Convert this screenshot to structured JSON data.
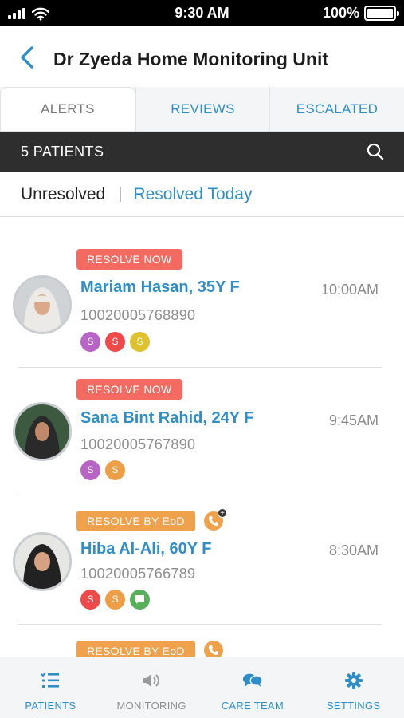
{
  "status_bar": {
    "time": "9:30 AM",
    "battery": "100%"
  },
  "header": {
    "title": "Dr Zyeda Home Monitoring Unit"
  },
  "tabs": [
    {
      "label": "ALERTS",
      "active": true
    },
    {
      "label": "REVIEWS",
      "active": false
    },
    {
      "label": "ESCALATED",
      "active": false
    }
  ],
  "patients_bar": {
    "count_label": "5 PATIENTS"
  },
  "filter": {
    "unresolved": "Unresolved",
    "separator": "|",
    "resolved_today": "Resolved Today"
  },
  "patients": [
    {
      "badge": "RESOLVE NOW",
      "name": "Mariam Hasan, 35Y F",
      "time": "10:00AM",
      "id": "10020005768890",
      "chips": [
        {
          "label": "S",
          "color": "#b864c6"
        },
        {
          "label": "S",
          "color": "#ee4a4a"
        },
        {
          "label": "S",
          "color": "#ddc12e"
        }
      ]
    },
    {
      "badge": "RESOLVE NOW",
      "name": "Sana Bint Rahid, 24Y F",
      "time": "9:45AM",
      "id": "10020005767890",
      "chips": [
        {
          "label": "S",
          "color": "#b864c6"
        },
        {
          "label": "S",
          "color": "#ee9e46"
        }
      ]
    },
    {
      "badge": "RESOLVE BY EoD",
      "name": "Hiba Al-Ali, 60Y F",
      "time": "8:30AM",
      "id": "10020005766789",
      "chips": [
        {
          "label": "S",
          "color": "#ee4a4a"
        },
        {
          "label": "S",
          "color": "#ee9e46"
        },
        {
          "label": "chat-icon",
          "color": "#59b05a"
        }
      ]
    },
    {
      "badge": "RESOLVE BY EoD"
    }
  ],
  "bottom_nav": [
    {
      "label": "PATIENTS",
      "icon": "patients-list-icon",
      "active": true
    },
    {
      "label": "MONITORING",
      "icon": "monitoring-icon",
      "active": false
    },
    {
      "label": "CARE TEAM",
      "icon": "care-team-icon",
      "active": false
    },
    {
      "label": "SETTINGS",
      "icon": "gear-icon",
      "active": false
    }
  ],
  "colors": {
    "accent": "#2f8ec8",
    "resolve_now": "#f26a60",
    "resolve_eod": "#f0a14c",
    "dark_bar": "#2e2e2e"
  }
}
